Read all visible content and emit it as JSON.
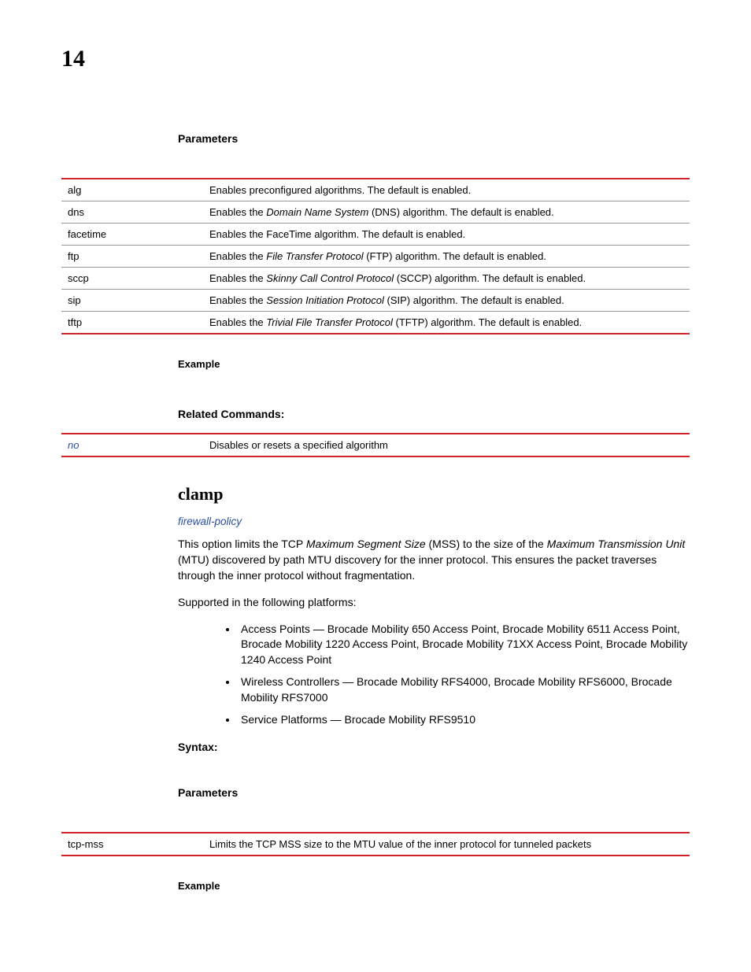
{
  "page_number": "14",
  "s1": {
    "parameters_label": "Parameters",
    "params": [
      {
        "k": "alg",
        "v": "Enables preconfigured algorithms. The default is enabled."
      },
      {
        "k": "dns",
        "v_pre": "Enables the ",
        "v_it": "Domain Name System",
        "v_post": " (DNS) algorithm. The default is enabled."
      },
      {
        "k": "facetime",
        "v": "Enables the FaceTime algorithm. The default is enabled."
      },
      {
        "k": "ftp",
        "v_pre": "Enables the ",
        "v_it": "File Transfer Protocol",
        "v_post": " (FTP) algorithm. The default is enabled."
      },
      {
        "k": "sccp",
        "v_pre": "Enables the ",
        "v_it": "Skinny Call Control Protocol",
        "v_post": " (SCCP) algorithm. The default is enabled."
      },
      {
        "k": "sip",
        "v_pre": "Enables the ",
        "v_it": "Session Initiation Protocol",
        "v_post": " (SIP) algorithm. The default is enabled."
      },
      {
        "k": "tftp",
        "v_pre": "Enables the ",
        "v_it": "Trivial File Transfer Protocol",
        "v_post": " (TFTP) algorithm. The default is enabled."
      }
    ],
    "example_label": "Example",
    "related_label": "Related Commands:",
    "related": {
      "k": "no",
      "v": "Disables or resets a specified algorithm"
    }
  },
  "s2": {
    "heading": "clamp",
    "link": "firewall-policy",
    "desc_parts": {
      "a": "This option limits the TCP ",
      "b": "Maximum Segment Size",
      "c": " (MSS) to the size of the ",
      "d": "Maximum Transmission Unit",
      "e": " (MTU) discovered by path MTU discovery for the inner protocol. This ensures the packet traverses through the inner protocol without fragmentation."
    },
    "supported_label": "Supported in the following platforms:",
    "bullets": [
      "Access Points — Brocade Mobility 650 Access Point, Brocade Mobility 6511 Access Point, Brocade Mobility 1220 Access Point, Brocade Mobility 71XX Access Point, Brocade Mobility 1240 Access Point",
      "Wireless Controllers — Brocade Mobility RFS4000, Brocade Mobility RFS6000, Brocade Mobility RFS7000",
      "Service Platforms — Brocade Mobility RFS9510"
    ],
    "syntax_label": "Syntax:",
    "parameters_label": "Parameters",
    "params": [
      {
        "k": "tcp-mss",
        "v": "Limits the TCP MSS size to the MTU value of the inner protocol for tunneled packets"
      }
    ],
    "example_label": "Example"
  }
}
